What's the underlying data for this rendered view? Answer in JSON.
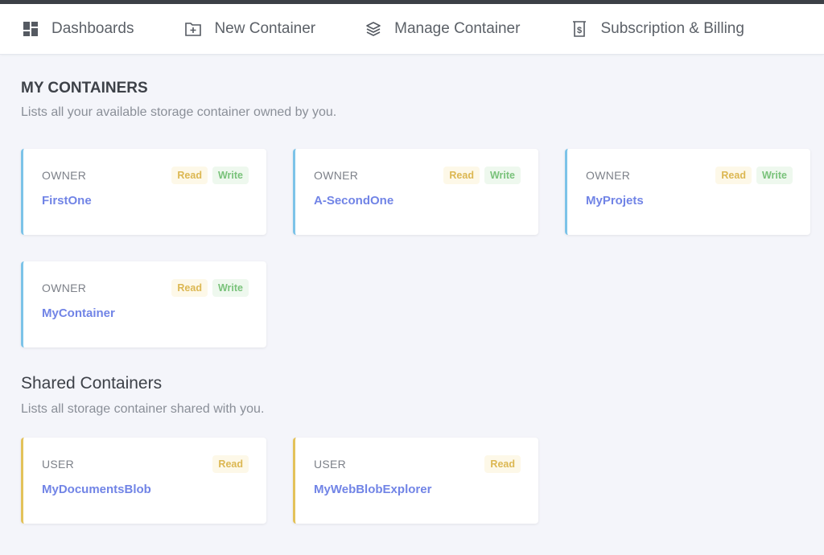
{
  "nav": {
    "items": [
      {
        "label": "Dashboards",
        "icon": "dashboard-grid-icon"
      },
      {
        "label": "New Container",
        "icon": "folder-plus-icon"
      },
      {
        "label": "Manage Container",
        "icon": "layers-icon"
      },
      {
        "label": "Subscription & Billing",
        "icon": "dollar-receipt-icon"
      }
    ]
  },
  "my_containers": {
    "title": "MY CONTAINERS",
    "subtitle": "Lists all your available storage container owned by you.",
    "cards": [
      {
        "role": "OWNER",
        "name": "FirstOne",
        "badges": [
          "Read",
          "Write"
        ]
      },
      {
        "role": "OWNER",
        "name": "A-SecondOne",
        "badges": [
          "Read",
          "Write"
        ]
      },
      {
        "role": "OWNER",
        "name": "MyProjets",
        "badges": [
          "Read",
          "Write"
        ]
      },
      {
        "role": "OWNER",
        "name": "MyContainer",
        "badges": [
          "Read",
          "Write"
        ]
      }
    ]
  },
  "shared_containers": {
    "title": "Shared Containers",
    "subtitle": "Lists all storage container shared with you.",
    "cards": [
      {
        "role": "USER",
        "name": "MyDocumentsBlob",
        "badges": [
          "Read"
        ]
      },
      {
        "role": "USER",
        "name": "MyWebBlobExplorer",
        "badges": [
          "Read"
        ]
      }
    ]
  },
  "colors": {
    "owner_accent": "#7cc3e8",
    "shared_accent": "#e3c25a",
    "name_link": "#7184e6",
    "read_badge": "#dcb752",
    "write_badge": "#79c27a"
  }
}
